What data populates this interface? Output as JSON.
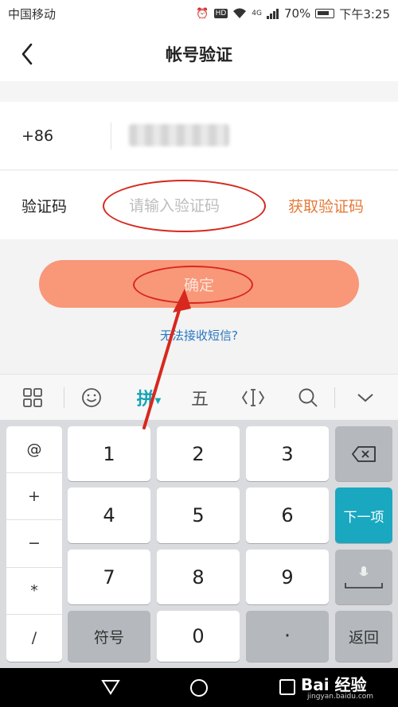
{
  "status_bar": {
    "carrier": "中国移动",
    "hd": "HD",
    "network": "4G",
    "battery": "70%",
    "time": "下午3:25"
  },
  "header": {
    "title": "帐号验证"
  },
  "form": {
    "phone_prefix": "+86",
    "phone_value": "",
    "code_label": "验证码",
    "code_placeholder": "请输入验证码",
    "get_code_label": "获取验证码"
  },
  "confirm_label": "确定",
  "no_sms_label": "无法接收短信?",
  "ime_toolbar": {
    "pinyin_label": "拼",
    "wubi_label": "五"
  },
  "keyboard": {
    "side_keys": [
      "@",
      "+",
      "−",
      "*",
      "/"
    ],
    "digits": [
      "1",
      "2",
      "3",
      "4",
      "5",
      "6",
      "7",
      "8",
      "9",
      "0"
    ],
    "symbols_label": "符号",
    "dot_label": "·",
    "next_label": "下一项",
    "return_label": "返回"
  },
  "watermark": {
    "brand": "Bai 经验",
    "url": "jingyan.baidu.com"
  },
  "colors": {
    "accent_orange": "#e57a3a",
    "confirm_button": "#f99779",
    "link_blue": "#2a77c0",
    "ime_teal": "#19a8c0",
    "annotation_red": "#d7281e"
  }
}
